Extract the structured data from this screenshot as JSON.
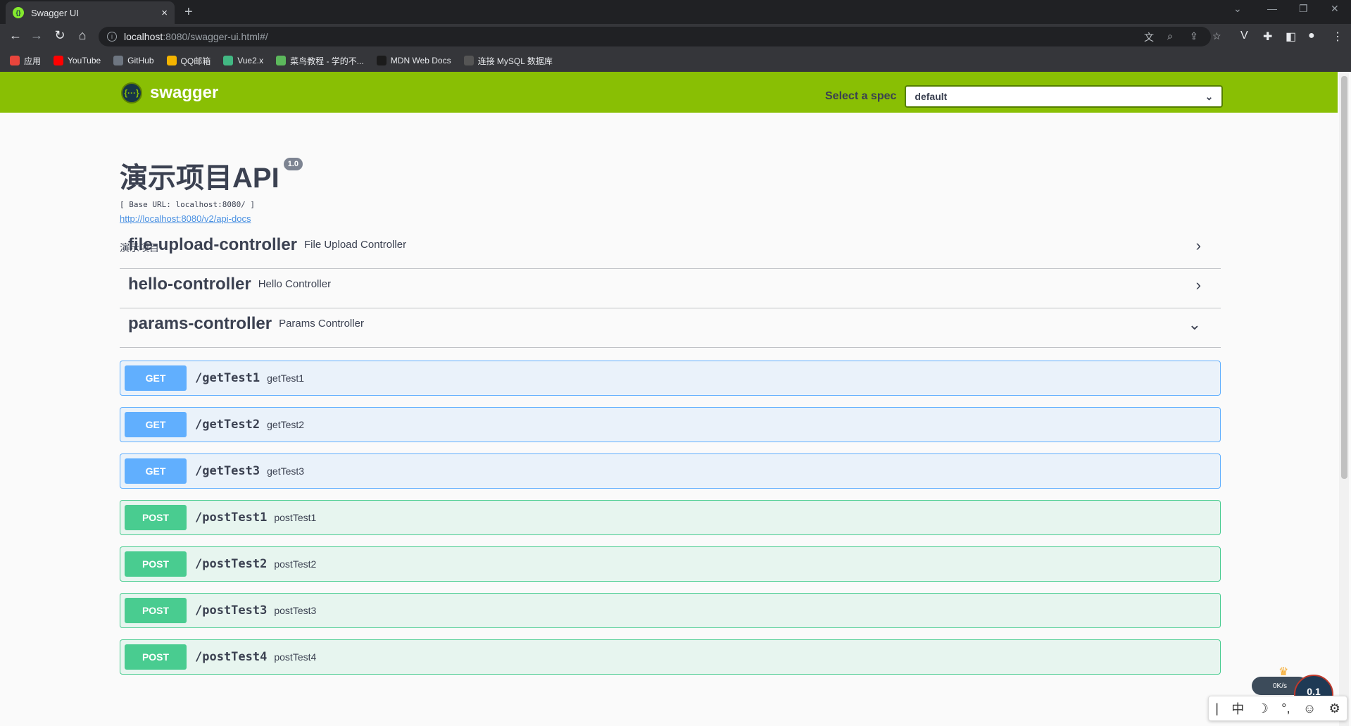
{
  "browser": {
    "tab_title": "Swagger UI",
    "tab_close": "×",
    "new_tab": "+",
    "url_host": "localhost",
    "url_path": ":8080/swagger-ui.html#/",
    "bookmarks": [
      {
        "label": "应用",
        "icon": "apps-grid-icon",
        "color": "#e8453c"
      },
      {
        "label": "YouTube",
        "icon": "youtube-icon",
        "color": "#ff0000"
      },
      {
        "label": "GitHub",
        "icon": "github-icon",
        "color": "#6e7681"
      },
      {
        "label": "QQ邮箱",
        "icon": "qq-mail-icon",
        "color": "#f4b400"
      },
      {
        "label": "Vue2.x",
        "icon": "vue-icon",
        "color": "#42b883"
      },
      {
        "label": "菜鸟教程 - 学的不...",
        "icon": "runoob-icon",
        "color": "#5cb85c"
      },
      {
        "label": "MDN Web Docs",
        "icon": "mdn-icon",
        "color": "#1b1b1b"
      },
      {
        "label": "连接 MySQL 数据库",
        "icon": "cube-icon",
        "color": "#555"
      }
    ]
  },
  "swagger": {
    "logo_text": "swagger",
    "logo_glyph": "{···}",
    "spec_label": "Select a spec",
    "spec_value": "default",
    "title": "演示项目API",
    "version": "1.0",
    "base_url": "[ Base URL: localhost:8080/ ]",
    "docs_link": "http://localhost:8080/v2/api-docs",
    "description": "演示项目",
    "tags": [
      {
        "name": "file-upload-controller",
        "desc": "File Upload Controller",
        "expanded": false
      },
      {
        "name": "hello-controller",
        "desc": "Hello Controller",
        "expanded": false
      },
      {
        "name": "params-controller",
        "desc": "Params Controller",
        "expanded": true
      }
    ],
    "operations": [
      {
        "method": "GET",
        "path": "/getTest1",
        "summary": "getTest1"
      },
      {
        "method": "GET",
        "path": "/getTest2",
        "summary": "getTest2"
      },
      {
        "method": "GET",
        "path": "/getTest3",
        "summary": "getTest3"
      },
      {
        "method": "POST",
        "path": "/postTest1",
        "summary": "postTest1"
      },
      {
        "method": "POST",
        "path": "/postTest2",
        "summary": "postTest2"
      },
      {
        "method": "POST",
        "path": "/postTest3",
        "summary": "postTest3"
      },
      {
        "method": "POST",
        "path": "/postTest4",
        "summary": "postTest4"
      }
    ]
  },
  "overlays": {
    "net_speed": "0K/s",
    "ime_chinese": "中",
    "ime_punct": "°,",
    "net_value": "0.1"
  },
  "colors": {
    "swagger_green": "#89bf04",
    "get_blue": "#61affe",
    "post_green": "#49cc90"
  }
}
